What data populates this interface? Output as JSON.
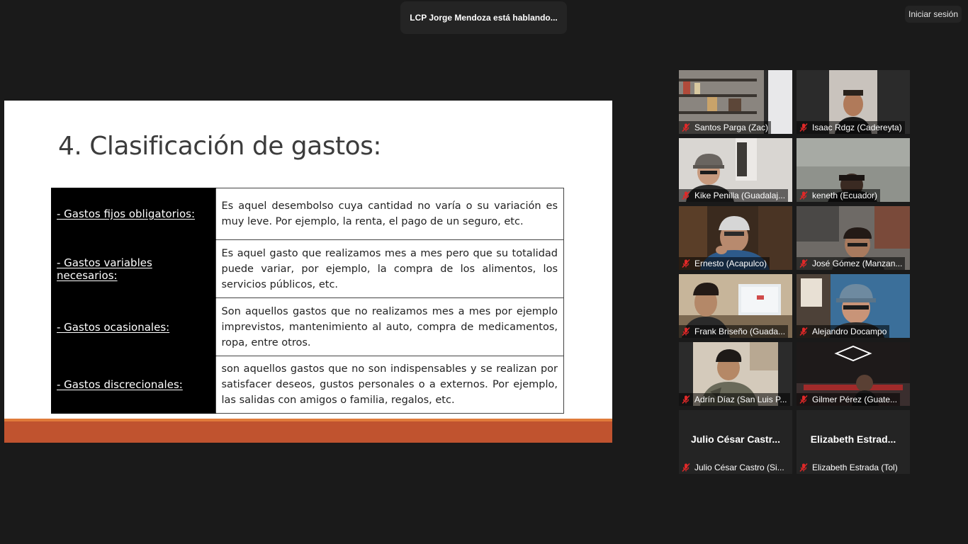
{
  "meeting": {
    "speaker_notice": "LCP Jorge Mendoza está hablando...",
    "sign_in_label": "Iniciar sesión"
  },
  "slide": {
    "title": "4. Clasificación de gastos:",
    "rows": [
      {
        "term": "- Gastos fijos obligatorios:",
        "definition": "Es aquel desembolso cuya cantidad no varía o su variación es muy leve. Por ejemplo, la renta, el pago de un seguro, etc."
      },
      {
        "term": "- Gastos variables necesarios:",
        "definition": "Es aquel gasto que realizamos mes a mes pero que su totalidad puede variar, por ejemplo, la compra de los alimentos, los servicios públicos, etc."
      },
      {
        "term": "- Gastos ocasionales:",
        "definition": "Son aquellos gastos que no realizamos mes a mes por ejemplo imprevistos, mantenimiento al auto, compra de medicamentos, ropa, entre otros."
      },
      {
        "term": "- Gastos discrecionales:",
        "definition": "son aquellos gastos que no son indispensables y se realizan por satisfacer deseos, gustos personales o a externos. Por ejemplo, las salidas con amigos o familia, regalos, etc."
      }
    ],
    "colors": {
      "footer": "#c0532f",
      "footer_accent": "#e07b3a",
      "term_bg": "#000000"
    }
  },
  "participants": [
    {
      "name": "Santos Parga (Zac)",
      "video": true,
      "muted": true
    },
    {
      "name": "Isaac Rdgz (Cadereyta)",
      "video": true,
      "muted": true
    },
    {
      "name": "Kike Penilla (Guadalaj...",
      "video": true,
      "muted": true
    },
    {
      "name": "keneth (Ecuador)",
      "video": true,
      "muted": true
    },
    {
      "name": "Ernesto (Acapulco)",
      "video": true,
      "muted": true
    },
    {
      "name": "José Gómez (Manzan...",
      "video": true,
      "muted": true
    },
    {
      "name": "Frank Briseño (Guada...",
      "video": true,
      "muted": true
    },
    {
      "name": "Alejandro Docampo",
      "video": true,
      "muted": true
    },
    {
      "name": "Adrín Díaz (San Luis P...",
      "video": true,
      "muted": true
    },
    {
      "name": "Gilmer Pérez (Guate...",
      "video": true,
      "muted": true
    },
    {
      "name": "Julio César Castro (Si...",
      "display_name": "Julio César Castr...",
      "video": false,
      "muted": true
    },
    {
      "name": "Elizabeth Estrada (Tol)",
      "display_name": "Elizabeth  Estrad...",
      "video": false,
      "muted": true
    }
  ],
  "icons": {
    "muted": "mic-muted-icon"
  },
  "colors": {
    "muted_icon": "#e02828",
    "background": "#1a1a1a"
  }
}
